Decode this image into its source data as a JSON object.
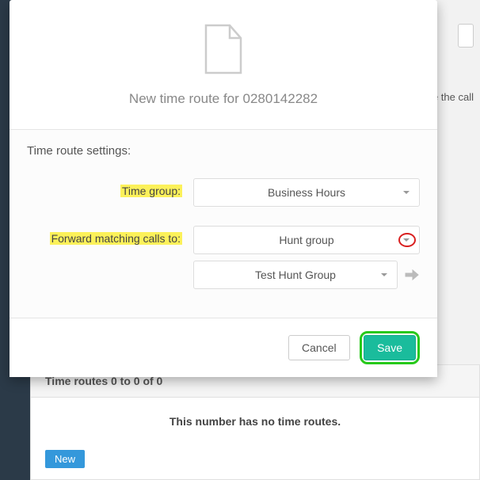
{
  "background": {
    "partial_text": "le the call"
  },
  "time_routes_card": {
    "header": "Time routes 0 to 0 of 0",
    "empty_msg": "This number has no time routes.",
    "new_btn": "New"
  },
  "modal": {
    "title": "New time route for 0280142282",
    "section_heading": "Time route settings:",
    "time_group": {
      "label": "Time group:",
      "value": "Business Hours"
    },
    "forward": {
      "label": "Forward matching calls to:",
      "type_value": "Hunt group",
      "target_value": "Test Hunt Group"
    },
    "cancel_label": "Cancel",
    "save_label": "Save"
  }
}
